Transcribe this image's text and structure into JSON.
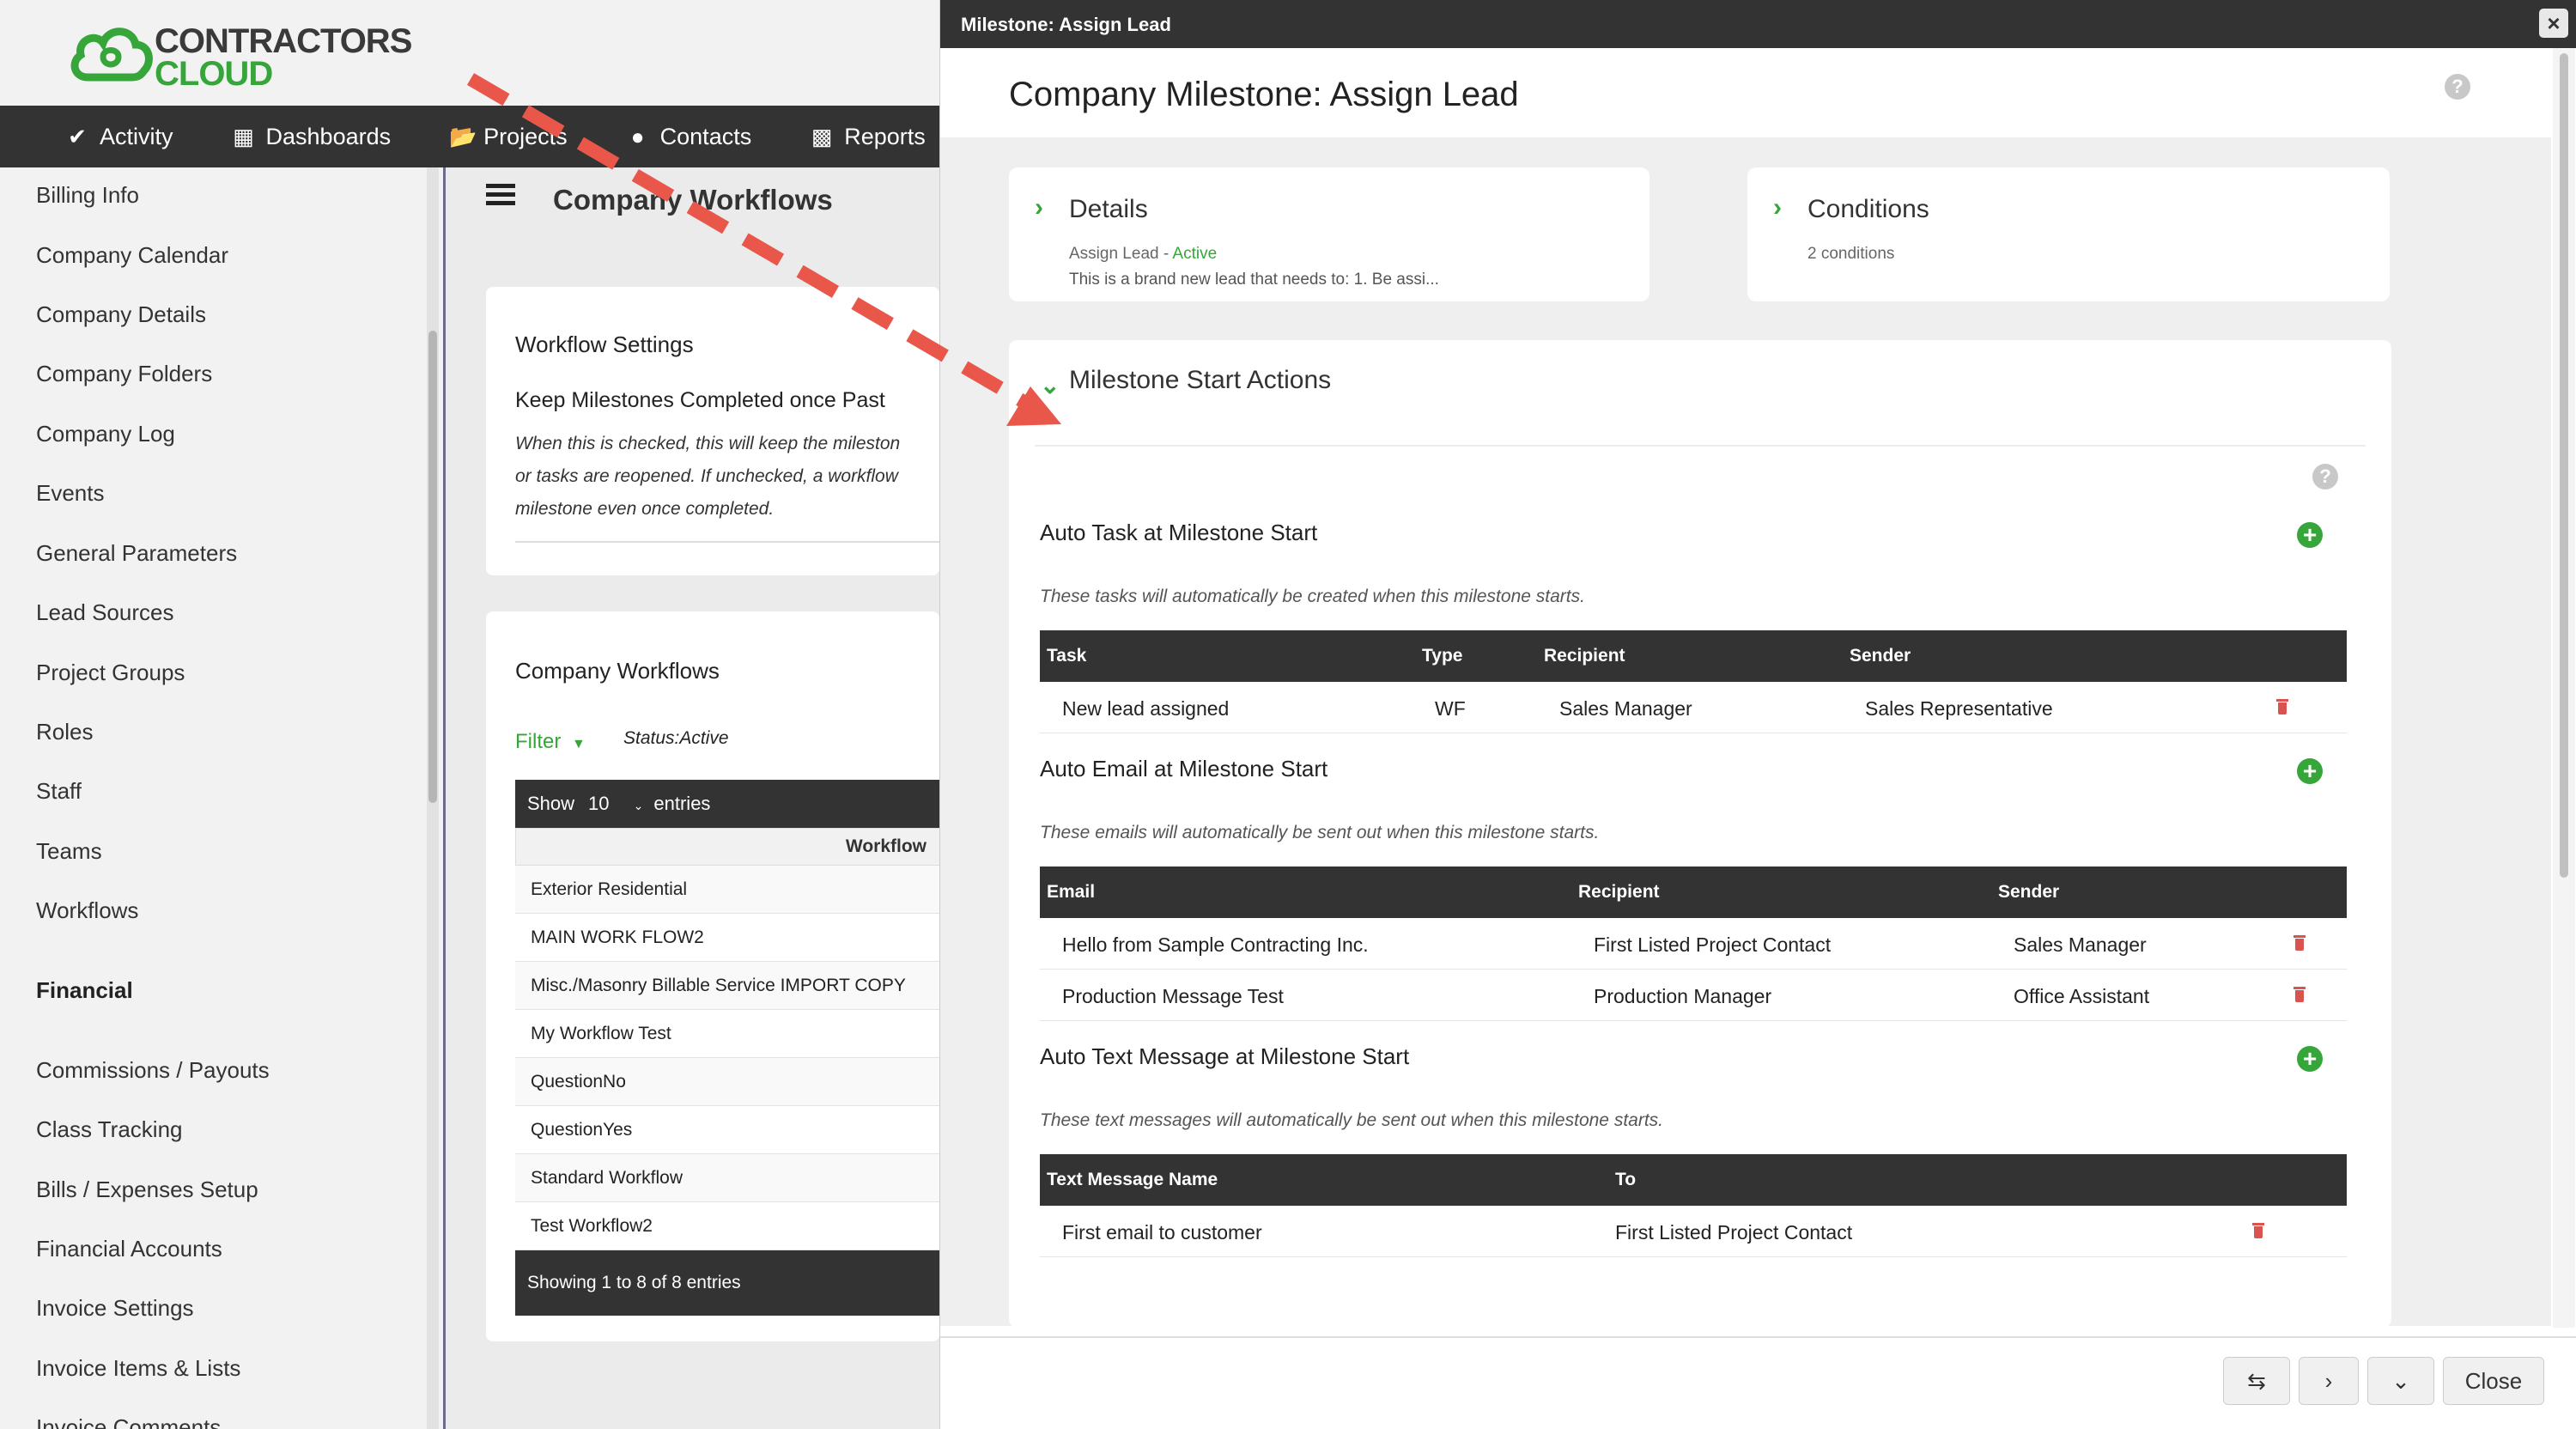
{
  "logo": {
    "line1": "CONTRACTORS",
    "line2": "CLOUD"
  },
  "topnav": [
    {
      "label": "Activity",
      "icon": "check-circle-icon"
    },
    {
      "label": "Dashboards",
      "icon": "grid-icon"
    },
    {
      "label": "Projects",
      "icon": "folder-open-icon"
    },
    {
      "label": "Contacts",
      "icon": "users-icon"
    },
    {
      "label": "Reports",
      "icon": "bar-chart-icon"
    }
  ],
  "sidebar": {
    "items": [
      "Billing Info",
      "Company Calendar",
      "Company Details",
      "Company Folders",
      "Company Log",
      "Events",
      "General Parameters",
      "Lead Sources",
      "Project Groups",
      "Roles",
      "Staff",
      "Teams",
      "Workflows"
    ],
    "financial_heading": "Financial",
    "financial_items": [
      "Commissions / Payouts",
      "Class Tracking",
      "Bills / Expenses Setup",
      "Financial Accounts",
      "Invoice Settings",
      "Invoice Items & Lists",
      "Invoice Comments"
    ]
  },
  "main": {
    "title": "Company Workflows",
    "settings": {
      "heading": "Workflow Settings",
      "option": "Keep Milestones Completed once Past",
      "desc_lines": [
        "When this is checked, this will keep the mileston",
        "or tasks are reopened. If unchecked, a workflow",
        "milestone even once completed."
      ]
    },
    "workflows": {
      "heading": "Company Workflows",
      "filter_label": "Filter",
      "status_label": "Status:Active",
      "show_label": "Show",
      "show_value": "10",
      "entries_label": "entries",
      "column": "Workflow",
      "rows": [
        "Exterior Residential",
        "MAIN WORK FLOW2",
        "Misc./Masonry Billable Service IMPORT COPY",
        "My Workflow Test",
        "QuestionNo",
        "QuestionYes",
        "Standard Workflow",
        "Test Workflow2"
      ],
      "footer": "Showing 1 to 8 of 8 entries"
    }
  },
  "modal": {
    "window_title": "Milestone: Assign Lead",
    "close_x": "×",
    "title": "Company Milestone: Assign Lead",
    "details": {
      "title": "Details",
      "name": "Assign Lead",
      "separator": " - ",
      "status": "Active",
      "description": "This is a brand new lead that needs to: 1. Be assi..."
    },
    "conditions": {
      "title": "Conditions",
      "summary": "2 conditions"
    },
    "start_actions": {
      "title": "Milestone Start Actions",
      "tasks": {
        "title": "Auto Task at Milestone Start",
        "desc": "These tasks will automatically be created when this milestone starts.",
        "columns": [
          "Task",
          "Type",
          "Recipient",
          "Sender"
        ],
        "rows": [
          {
            "task": "New lead assigned",
            "type": "WF",
            "recipient": "Sales Manager",
            "sender": "Sales Representative"
          }
        ]
      },
      "emails": {
        "title": "Auto Email at Milestone Start",
        "desc": "These emails will automatically be sent out when this milestone starts.",
        "columns": [
          "Email",
          "Recipient",
          "Sender"
        ],
        "rows": [
          {
            "email": "Hello from Sample Contracting Inc.",
            "recipient": "First Listed Project Contact",
            "sender": "Sales Manager"
          },
          {
            "email": "Production Message Test",
            "recipient": "Production Manager",
            "sender": "Office Assistant"
          }
        ]
      },
      "texts": {
        "title": "Auto Text Message at Milestone Start",
        "desc": "These text messages will automatically be sent out when this milestone starts.",
        "columns": [
          "Text Message Name",
          "To"
        ],
        "rows": [
          {
            "name": "First email to customer",
            "to": "First Listed Project Contact"
          }
        ]
      }
    },
    "footer": {
      "close_label": "Close"
    }
  },
  "colors": {
    "accent_green": "#36a53a",
    "dark_bar": "#333333",
    "delete_red": "#d9534f",
    "arrow": "#e8574a"
  }
}
